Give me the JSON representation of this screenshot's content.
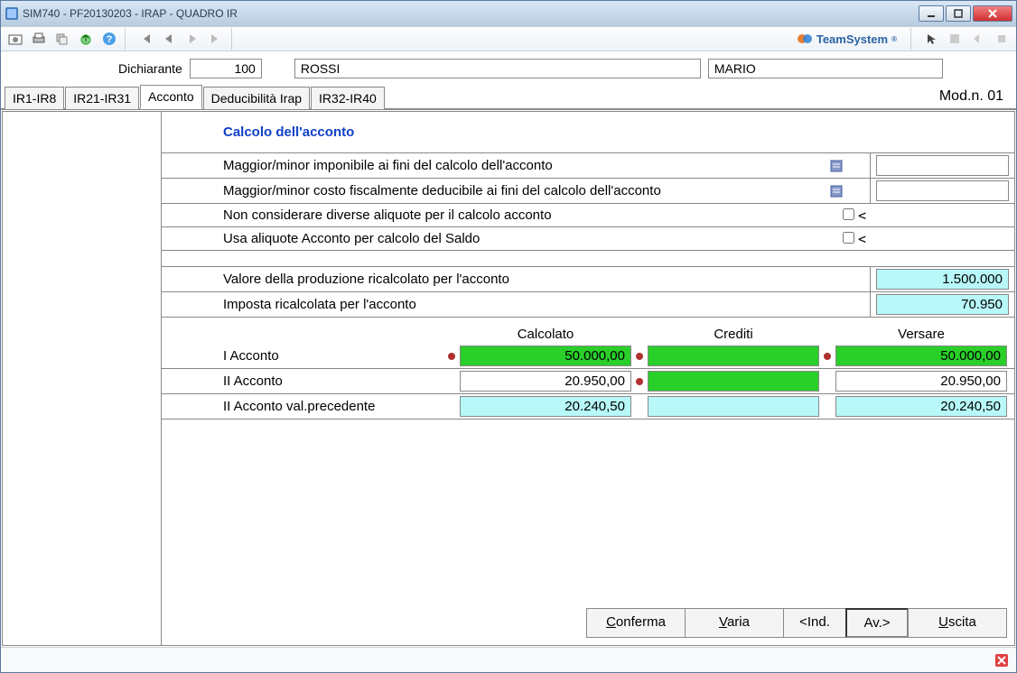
{
  "window": {
    "title": "SIM740  -  PF20130203 -  IRAP - QUADRO IR"
  },
  "brand": "TeamSystem",
  "header": {
    "dichiarante_label": "Dichiarante",
    "dichiarante_code": "100",
    "surname": "ROSSI",
    "name": "MARIO"
  },
  "tabs": {
    "items": [
      "IR1-IR8",
      "IR21-IR31",
      "Acconto",
      "Deducibilità Irap",
      "IR32-IR40"
    ],
    "active": "Acconto",
    "modn": "Mod.n. 01"
  },
  "section_title": "Calcolo dell'acconto",
  "rows": {
    "r1": "Maggior/minor imponibile ai fini del calcolo dell'acconto",
    "r2": "Maggior/minor costo fiscalmente deducibile ai fini del calcolo dell'acconto",
    "r3": "Non considerare diverse aliquote per il calcolo acconto",
    "r4": "Usa aliquote Acconto per calcolo del Saldo",
    "r5": "Valore della produzione ricalcolato per l'acconto",
    "r5v": "1.500.000",
    "r6": "Imposta ricalcolata per l'acconto",
    "r6v": "70.950"
  },
  "calc": {
    "h1": "Calcolato",
    "h2": "Crediti",
    "h3": "Versare",
    "row1": {
      "label": "I Acconto",
      "calc": "50.000,00",
      "cred": "",
      "vers": "50.000,00"
    },
    "row2": {
      "label": "II Acconto",
      "calc": "20.950,00",
      "cred": "",
      "vers": "20.950,00"
    },
    "row3": {
      "label": "II Acconto val.precedente",
      "calc": "20.240,50",
      "cred": "",
      "vers": "20.240,50"
    }
  },
  "buttons": {
    "conferma": "Conferma",
    "varia": "Varia",
    "ind": "<Ind.",
    "av": "Av.>",
    "uscita": "Uscita"
  }
}
